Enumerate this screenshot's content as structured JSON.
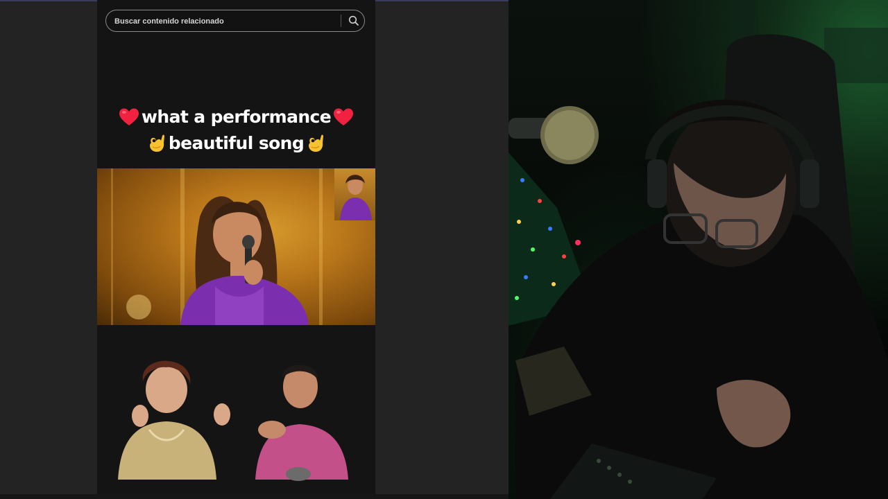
{
  "search": {
    "placeholder": "Buscar contenido relacionado"
  },
  "caption": {
    "line1": "what a performance",
    "line2": "beautiful song"
  },
  "icons": {
    "search": "search-icon",
    "heart": "red-heart-emoji",
    "ok_hand": "ok-hand-emoji"
  },
  "colors": {
    "page_background": "#202020",
    "feed_background": "#141414",
    "caption_text": "#ffffff",
    "search_border": "#8b8b8b",
    "stage_gold": "#d69a2d",
    "outfit_purple": "#7b2fae",
    "webcam_green": "#1b5a2d"
  }
}
